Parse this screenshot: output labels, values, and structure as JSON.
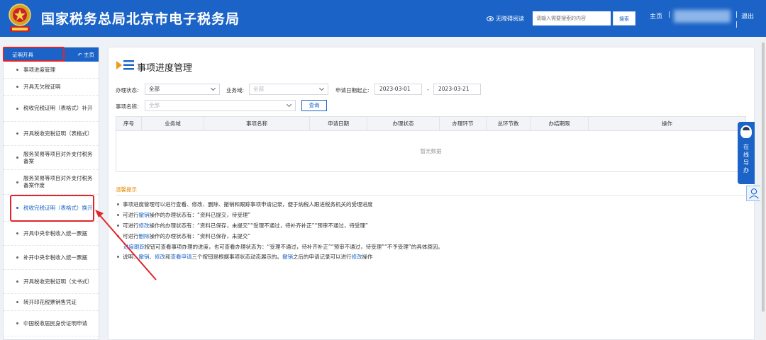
{
  "header": {
    "site_title": "国家税务总局北京市电子税务局",
    "accessibility_label": "无障碍阅读",
    "search_placeholder": "请输入需要搜索的内容",
    "search_button": "搜索",
    "home_link": "主页",
    "separator": "|",
    "logout": "退出",
    "brand_color": "#1b63c6"
  },
  "sidebar": {
    "section_tab": "证明开具",
    "home_label": "主页",
    "items": [
      {
        "label": "事项进度管理"
      },
      {
        "label": "开具无欠税证明"
      },
      {
        "label": "税收完税证明（表格式）补开"
      },
      {
        "label": "开具税收完税证明（表格式）"
      },
      {
        "label": "服务贸易等项目对外支付税务备案"
      },
      {
        "label": "服务贸易等项目对外支付税务备案作废"
      },
      {
        "label": "税收完税证明（表格式）换开"
      },
      {
        "label": "开具中央非税收入统一票据"
      },
      {
        "label": "补开中央非税收入统一票据"
      },
      {
        "label": "开具税收完税证明（文书式）"
      },
      {
        "label": "转开印花税票销售凭证"
      },
      {
        "label": "中国税收居民身份证明申请"
      }
    ],
    "active_item": "税收完税证明（表格式）换开"
  },
  "main": {
    "page_title": "事项进度管理",
    "filters": {
      "status_label": "办理状态:",
      "status_value": "全部",
      "domain_label": "业务域:",
      "domain_placeholder": "全部",
      "date_label": "申请日期起止:",
      "date_start": "2023-03-01",
      "date_sep": "-",
      "date_end": "2023-03-21",
      "name_label": "事项名称:",
      "name_placeholder": "全部",
      "query_button": "查询"
    },
    "table": {
      "columns": [
        "序号",
        "业务域",
        "事项名称",
        "申请日期",
        "办理状态",
        "办理环节",
        "总环节数",
        "办结期限",
        "操作"
      ],
      "empty_text": "暂无数据"
    },
    "tips": {
      "title": "温馨提示",
      "line1": "事项进度管理可以进行查看、修改、删除、撤销和跟踪事项申请记录，便于纳税人跟进税务机关的受理进度",
      "l2_a": "可进行",
      "l2_k": "撤销",
      "l2_b": "操作的办理状态有：“资料已提交，待受理”",
      "l3_a": "可进行",
      "l3_k": "修改",
      "l3_b": "操作的办理状态有：“资料已保存，未提交”“受理不通过，待补齐补正”“预审不通过，待受理”",
      "l4_a": "可进行",
      "l4_k": "删除",
      "l4_b": "操作的办理状态有：“资料已保存，未提交”",
      "l5_k": "进度跟踪",
      "l5_b": "按钮可查看事项办理的进度，也可查看办理状态为：“受理不通过，待补齐补正”“预审不通过，待受理”“不予受理”的具体原因。",
      "l6_a": "说明：",
      "l6_k1": "撤销",
      "l6_s1": "、",
      "l6_k2": "修改",
      "l6_s2": "和",
      "l6_k3": "查看申请",
      "l6_b": "三个按钮是根据事项状态动态展示的。",
      "l6_k4": "撤销",
      "l6_c": "之后的申请记录可以进行",
      "l6_k5": "修改",
      "l6_d": "操作"
    }
  },
  "float": {
    "online_service": "在线导办"
  },
  "annotation_color": "#e0262a"
}
